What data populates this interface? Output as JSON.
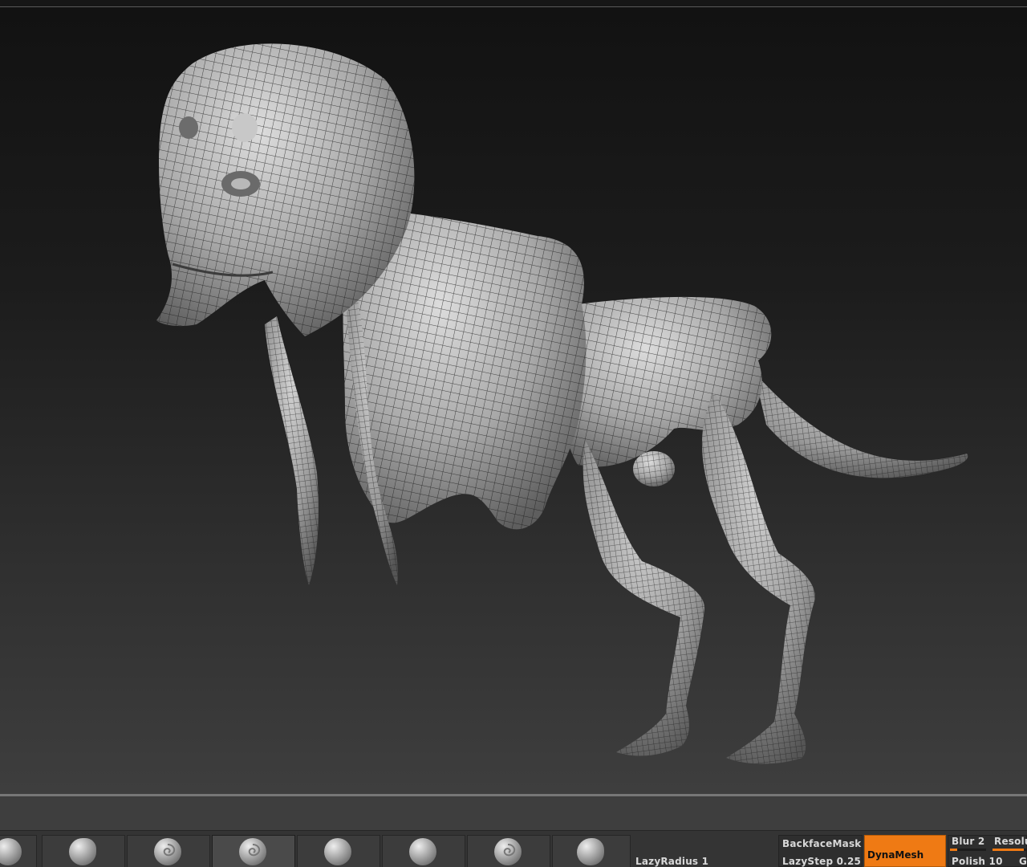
{
  "app": {
    "accent_color": "#ef7a14"
  },
  "viewport": {
    "content": "sculpted creature mesh with wireframe polyframe overlay"
  },
  "brush_shelf": {
    "slots": [
      {
        "icon": "brush-ball-icon",
        "active": false
      },
      {
        "icon": "brush-ball-icon",
        "active": false
      },
      {
        "icon": "brush-ball-icon",
        "active": false
      },
      {
        "icon": "brush-ball-icon",
        "active": true
      },
      {
        "icon": "brush-ball-icon",
        "active": false
      },
      {
        "icon": "brush-ball-icon",
        "active": false
      },
      {
        "icon": "brush-ball-icon",
        "active": false
      },
      {
        "icon": "brush-ball-icon",
        "active": false
      }
    ]
  },
  "controls": {
    "lazy_radius": "LazyRadius 1",
    "backface_mask": "BackfaceMask",
    "lazy_step": "LazyStep 0.25",
    "dynamesh": "DynaMesh",
    "blur": "Blur 2",
    "blur_value": 0.2,
    "resolution": "Resolu",
    "resolution_value": 0.9,
    "polish": "Polish 10",
    "polish_value": 0.1,
    "extra": "G"
  }
}
